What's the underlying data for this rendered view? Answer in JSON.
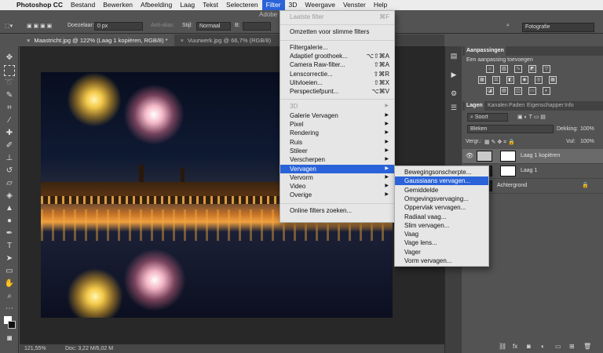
{
  "menubar": {
    "app_name": "Photoshop CC",
    "items": [
      "Bestand",
      "Bewerken",
      "Afbeelding",
      "Laag",
      "Tekst",
      "Selecteren",
      "Filter",
      "3D",
      "Weergave",
      "Venster",
      "Help"
    ],
    "active": "Filter"
  },
  "window_title": "Adobe",
  "options_bar": {
    "feather_label": "Doezelaar:",
    "feather_value": "0 px",
    "antialias_label": "Anti-alias",
    "style_label": "Stijl:",
    "style_value": "Normaal",
    "width_label": "B:",
    "workspace": "Fotografie"
  },
  "tabs": [
    {
      "close": "×",
      "label": "Maastricht.jpg @ 122% (Laag 1 kopiëren, RGB/8) *"
    },
    {
      "close": "×",
      "label": "Vuurwerk.jpg @ 66,7% (RGB/8)"
    }
  ],
  "status": {
    "zoom": "121,55%",
    "doc": "Doc: 3,22 M/6,02 M"
  },
  "filter_menu": {
    "items": [
      {
        "label": "Laatste filter",
        "shortcut": "⌘F",
        "disabled": true
      },
      {
        "sep": true
      },
      {
        "label": "Omzetten voor slimme filters"
      },
      {
        "sep": true
      },
      {
        "label": "Filtergalerie..."
      },
      {
        "label": "Adaptief groothoek...",
        "shortcut": "⌥⇧⌘A"
      },
      {
        "label": "Camera Raw-filter...",
        "shortcut": "⇧⌘A"
      },
      {
        "label": "Lenscorrectie...",
        "shortcut": "⇧⌘R"
      },
      {
        "label": "Uitvloeien...",
        "shortcut": "⇧⌘X"
      },
      {
        "label": "Perspectiefpunt...",
        "shortcut": "⌥⌘V"
      },
      {
        "sep": true
      },
      {
        "label": "3D",
        "submenu": true,
        "disabled": true
      },
      {
        "label": "Galerie Vervagen",
        "submenu": true
      },
      {
        "label": "Pixel",
        "submenu": true
      },
      {
        "label": "Rendering",
        "submenu": true
      },
      {
        "label": "Ruis",
        "submenu": true
      },
      {
        "label": "Stileer",
        "submenu": true
      },
      {
        "label": "Verscherpen",
        "submenu": true
      },
      {
        "label": "Vervagen",
        "submenu": true,
        "highlighted": true
      },
      {
        "label": "Vervorm",
        "submenu": true
      },
      {
        "label": "Video",
        "submenu": true
      },
      {
        "label": "Overige",
        "submenu": true
      },
      {
        "sep": true
      },
      {
        "label": "Online filters zoeken..."
      }
    ]
  },
  "blur_menu": {
    "items": [
      {
        "label": "Bewegingsonscherpte..."
      },
      {
        "label": "Gaussiaans vervagen...",
        "highlighted": true
      },
      {
        "label": "Gemiddelde"
      },
      {
        "label": "Omgevingsvervaging..."
      },
      {
        "label": "Oppervlak vervagen..."
      },
      {
        "label": "Radiaal vaag..."
      },
      {
        "label": "Slim vervagen..."
      },
      {
        "label": "Vaag"
      },
      {
        "label": "Vage lens..."
      },
      {
        "label": "Vager"
      },
      {
        "label": "Vorm vervagen..."
      }
    ]
  },
  "adjustments_panel": {
    "tab": "Aanpassingen",
    "subtitle": "Een aanpassing toevoegen"
  },
  "layers_panel": {
    "tabs": [
      "Lagen",
      "Kanalen",
      "Paden",
      "Eigenschapper",
      "Info"
    ],
    "filter_kind": "Soort",
    "blend_mode": "Bleken",
    "opacity_label": "Dekking:",
    "opacity": "100%",
    "lock_label": "Vergr.:",
    "fill_label": "Vul:",
    "fill": "100%",
    "layers": [
      {
        "name": "Laag 1 kopiëren",
        "selected": true,
        "visible": true,
        "mask": true
      },
      {
        "name": "Laag 1",
        "selected": false,
        "visible": false,
        "mask": true
      },
      {
        "name": "Achtergrond",
        "selected": false,
        "visible": false,
        "mask": false,
        "locked": true
      }
    ]
  },
  "colors": {
    "accent": "#2a63d9",
    "menu_bg": "#e6e6e6",
    "panel_bg": "#535353"
  }
}
